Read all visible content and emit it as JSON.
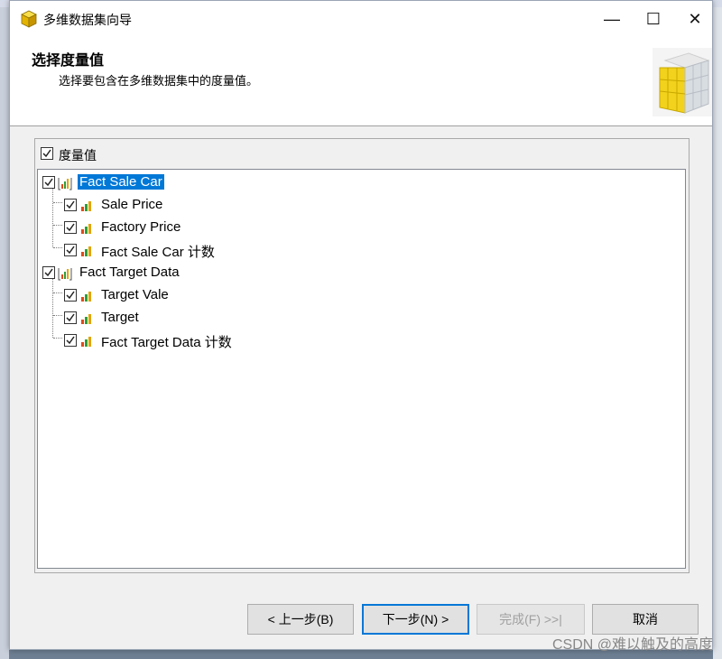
{
  "window": {
    "title": "多维数据集向导",
    "minimize_glyph": "—",
    "maximize_glyph": "☐",
    "close_glyph": "✕"
  },
  "header": {
    "title": "选择度量值",
    "subtitle": "选择要包含在多维数据集中的度量值。"
  },
  "measures_panel": {
    "label": "度量值",
    "checked": true
  },
  "tree": {
    "groups": [
      {
        "label": "Fact Sale Car",
        "checked": true,
        "selected": true,
        "items": [
          {
            "label": "Sale Price",
            "checked": true
          },
          {
            "label": "Factory Price",
            "checked": true
          },
          {
            "label": "Fact Sale Car 计数",
            "checked": true
          }
        ]
      },
      {
        "label": "Fact Target Data",
        "checked": true,
        "selected": false,
        "items": [
          {
            "label": "Target Vale",
            "checked": true
          },
          {
            "label": "Target",
            "checked": true
          },
          {
            "label": "Fact Target Data 计数",
            "checked": true
          }
        ]
      }
    ]
  },
  "buttons": {
    "back": "< 上一步(B)",
    "next": "下一步(N) >",
    "finish": "完成(F) >>|",
    "cancel": "取消"
  },
  "watermark": "CSDN @难以触及的高度",
  "colors": {
    "selection": "#0078d7",
    "cube_yellow": "#f2d21c"
  },
  "icons": {
    "title": "cube-icon",
    "logo": "cube-logo",
    "measure_group": "measure-group-icon",
    "measure": "measure-icon"
  }
}
